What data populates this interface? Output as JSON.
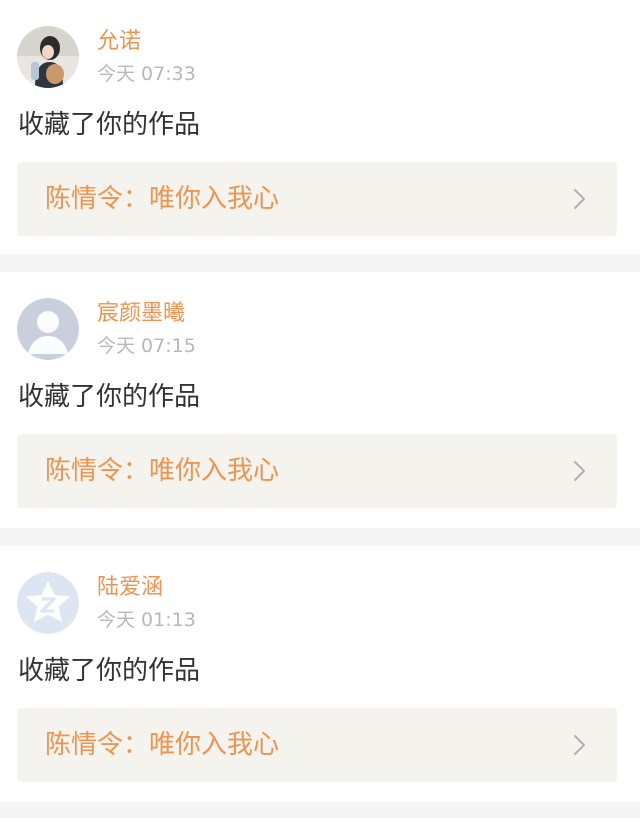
{
  "notifications": [
    {
      "username": "允诺",
      "time": "今天 07:33",
      "action": "收藏了你的作品",
      "work_title": "陈情令：唯你入我心",
      "avatar_icon": "user-photo-avatar"
    },
    {
      "username": "宸颜墨曦",
      "time": "今天 07:15",
      "action": "收藏了你的作品",
      "work_title": "陈情令：唯你入我心",
      "avatar_icon": "default-person-avatar"
    },
    {
      "username": "陆爱涵",
      "time": "今天 01:13",
      "action": "收藏了你的作品",
      "work_title": "陈情令：唯你入我心",
      "avatar_icon": "qq-star-avatar"
    }
  ],
  "colors": {
    "accent": "#ef9450",
    "timestamp": "#b8b8b8",
    "body_text": "#333333",
    "work_box_bg": "#f4f3ee",
    "page_bg": "#f5f5f5"
  }
}
